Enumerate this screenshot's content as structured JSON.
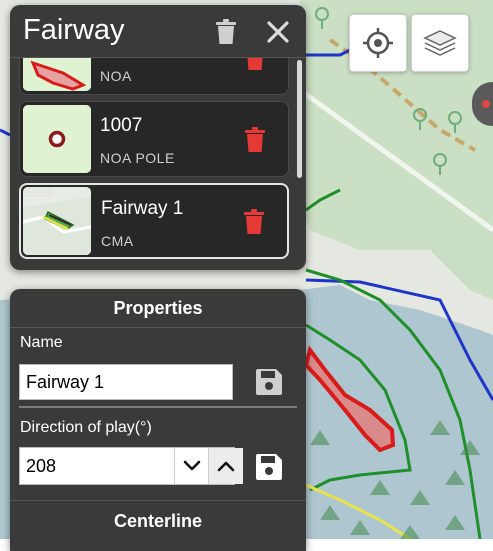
{
  "panel": {
    "title": "Fairway"
  },
  "list": {
    "items": [
      {
        "name": "",
        "type": "NOA",
        "selected": false
      },
      {
        "name": "1007",
        "type": "NOA POLE",
        "selected": false
      },
      {
        "name": "Fairway 1",
        "type": "CMA",
        "selected": true
      }
    ]
  },
  "properties": {
    "title": "Properties",
    "name_label": "Name",
    "name_value": "Fairway 1",
    "direction_label": "Direction of play(°)",
    "direction_value": "208",
    "centerline_title": "Centerline"
  },
  "icons": {
    "header_trash": "trash-icon",
    "header_close": "close-icon",
    "item_trash": "trash-icon",
    "save": "floppy-disk-icon",
    "locate": "crosshair-icon",
    "layers": "layers-icon",
    "step_down": "chevron-down-icon",
    "step_up": "chevron-up-icon"
  },
  "colors": {
    "panel_bg": "#3a3a3a",
    "item_bg": "#272727",
    "trash_red": "#e53935",
    "map_land": "#e4e8e1",
    "map_park": "#c9ddc2",
    "map_water": "#aec6cf",
    "boundary_blue": "#1e36c8",
    "line_green": "#1f8f2a",
    "feature_red": "#d81b1b",
    "line_yellow": "#e8e24a"
  }
}
